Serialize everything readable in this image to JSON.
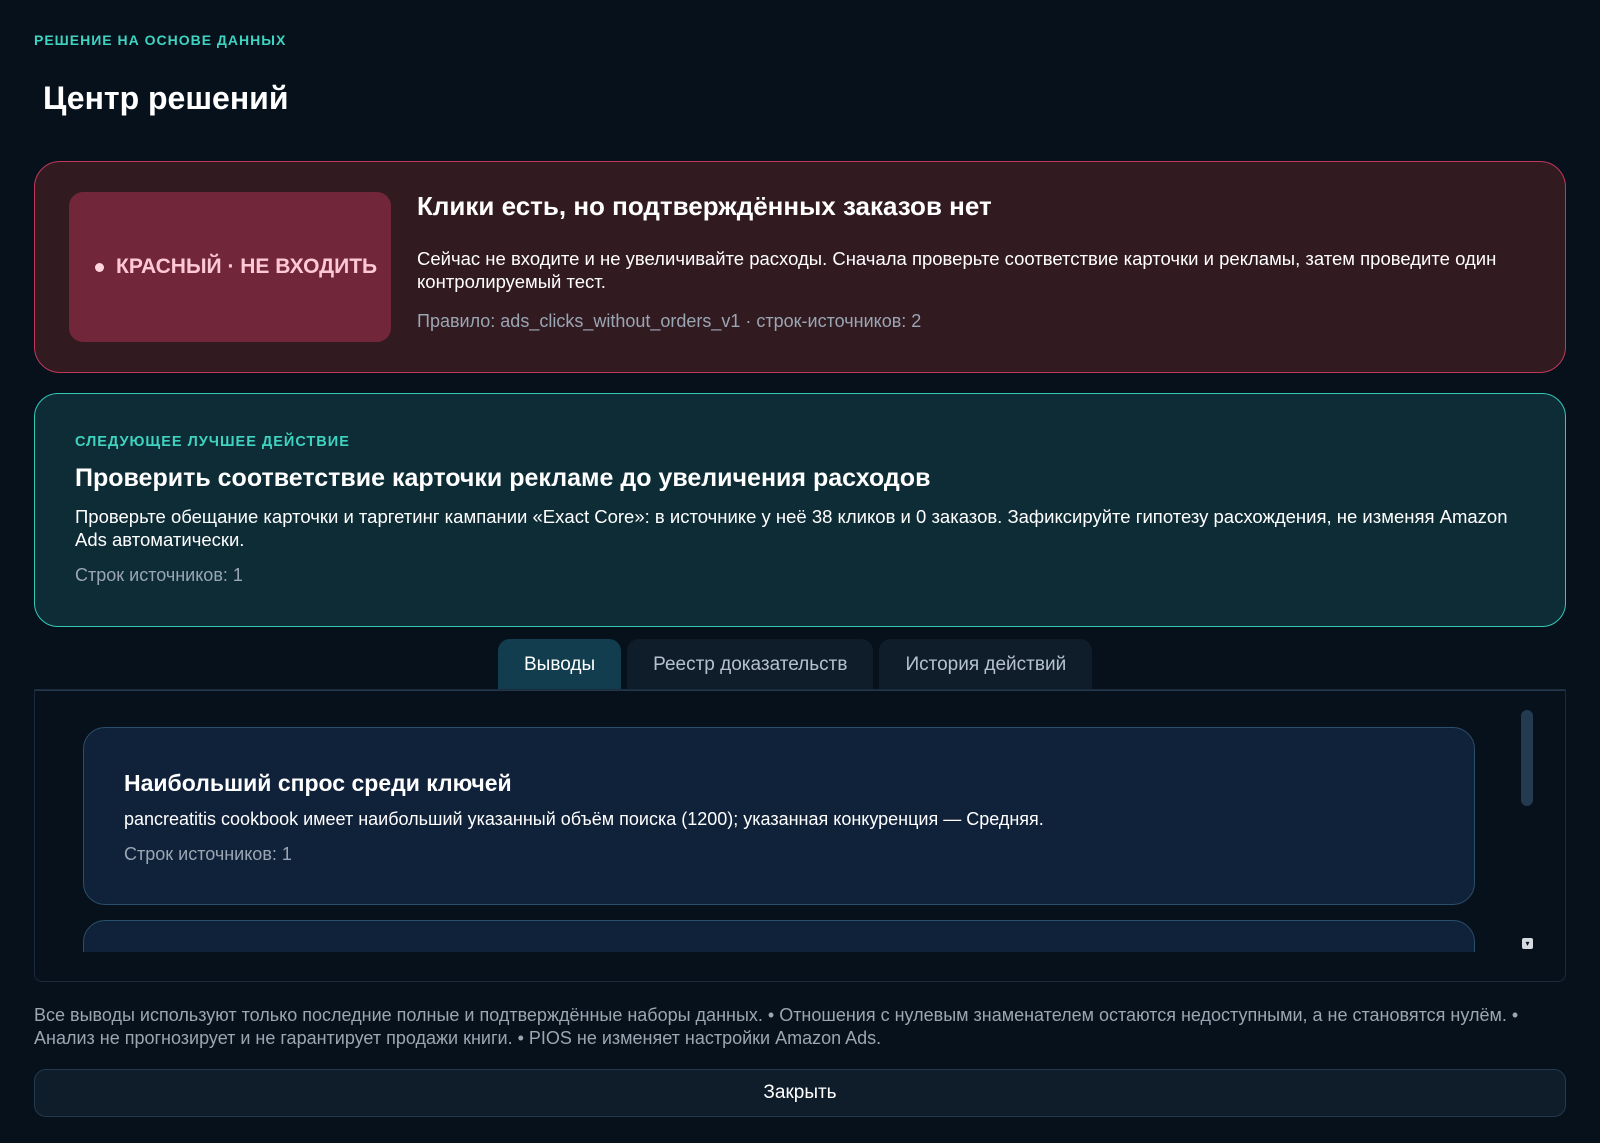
{
  "header": {
    "kicker": "РЕШЕНИЕ НА ОСНОВЕ ДАННЫХ",
    "title": "Центр решений"
  },
  "verdict": {
    "badge": "КРАСНЫЙ · НЕ ВХОДИТЬ",
    "title": "Клики есть, но подтверждённых заказов нет",
    "description": "Сейчас не входите и не увеличивайте расходы. Сначала проверьте соответствие карточки и рекламы, затем проведите один контролируемый тест.",
    "rule": "Правило: ads_clicks_without_orders_v1 · строк-источников: 2",
    "colors": {
      "border": "#c0385a",
      "badge_bg": "#71263a",
      "card_bg": "#321a21"
    }
  },
  "next_action": {
    "kicker": "СЛЕДУЮЩЕЕ ЛУЧШЕЕ ДЕЙСТВИЕ",
    "title": "Проверить соответствие карточки рекламе до увеличения расходов",
    "description": "Проверьте обещание карточки и таргетинг кампании «Exact Core»: в источнике у неё 38 кликов и 0 заказов. Зафиксируйте гипотезу расхождения, не изменяя Amazon Ads автоматически.",
    "sources": "Строк источников: 1",
    "colors": {
      "border": "#34c8b6",
      "card_bg": "#0d2c36"
    }
  },
  "tabs": [
    {
      "label": "Выводы",
      "active": true
    },
    {
      "label": "Реестр доказательств",
      "active": false
    },
    {
      "label": "История действий",
      "active": false
    }
  ],
  "insights": [
    {
      "title": "Наибольший спрос среди ключей",
      "description": "pancreatitis cookbook имеет наибольший указанный объём поиска (1200); указанная конкуренция — Средняя.",
      "sources": "Строк источников: 1"
    }
  ],
  "scroll_icon": "chevron-down-icon",
  "footnote": "Все выводы используют только последние полные и подтверждённые наборы данных.  •  Отношения с нулевым знаменателем остаются недоступными, а не становятся нулём.  •  Анализ не прогнозирует и не гарантирует продажи книги.  •  PIOS не изменяет настройки Amazon Ads.",
  "close_label": "Закрыть"
}
